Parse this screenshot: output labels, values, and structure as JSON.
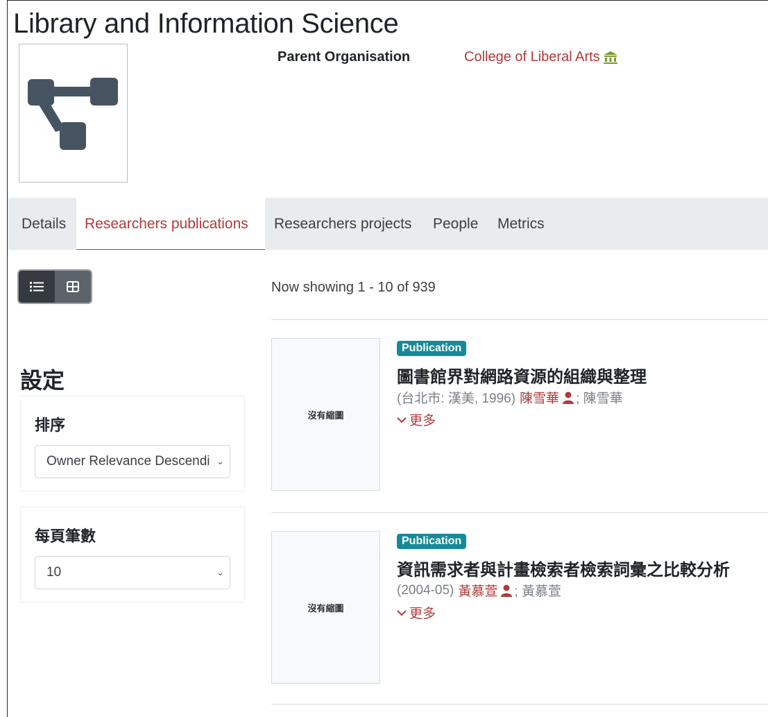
{
  "header": {
    "title": "Library and Information Science",
    "parent_label": "Parent Organisation",
    "parent_link": "College of Liberal Arts",
    "parent_icon": "institution-icon"
  },
  "logo": {
    "icon": "org-structure-icon",
    "color": "#465462"
  },
  "tabs": [
    {
      "label": "Details",
      "active": false
    },
    {
      "label": "Researchers publications",
      "active": true
    },
    {
      "label": "Researchers projects",
      "active": false
    },
    {
      "label": "People",
      "active": false
    },
    {
      "label": "Metrics",
      "active": false
    }
  ],
  "view_toggle": {
    "list_icon": "list-icon",
    "grid_icon": "grid-icon",
    "active": "list"
  },
  "results_summary": "Now showing 1 - 10 of 939",
  "settings": {
    "title": "設定",
    "sort": {
      "label": "排序",
      "value": "Owner Relevance Descending"
    },
    "per_page": {
      "label": "每頁筆數",
      "value": "10"
    }
  },
  "results": [
    {
      "thumbnail": "沒有縮圖",
      "badge": "Publication",
      "title": "圖書館界對網路資源的組織與整理",
      "source": "(台北市: 漢美, 1996)",
      "author": "陳雪華",
      "author_plain": "; 陳雪華",
      "more": "更多"
    },
    {
      "thumbnail": "沒有縮圖",
      "badge": "Publication",
      "title": "資訊需求者與計畫檢索者檢索詞彙之比較分析",
      "source": "(2004-05)",
      "author": "黃慕萱",
      "author_plain": "; 黃慕萱",
      "more": "更多"
    }
  ],
  "colors": {
    "accent": "#b03a3a",
    "badge": "#178a99",
    "tab_bar": "#e9ecef"
  }
}
